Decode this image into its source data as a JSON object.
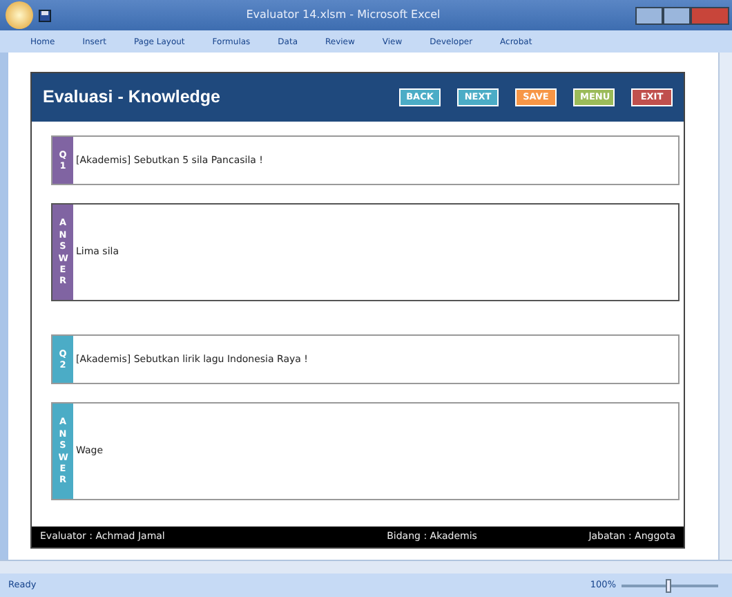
{
  "window": {
    "title": "Evaluator 14.xlsm - Microsoft Excel"
  },
  "ribbon_tabs": [
    "Home",
    "Insert",
    "Page Layout",
    "Formulas",
    "Data",
    "Review",
    "View",
    "Developer",
    "Acrobat"
  ],
  "form": {
    "title": "Evaluasi - Knowledge",
    "buttons": [
      {
        "label": "BACK",
        "color": "#4bacc6"
      },
      {
        "label": "NEXT",
        "color": "#4bacc6"
      },
      {
        "label": "SAVE",
        "color": "#f79646"
      },
      {
        "label": "MENU",
        "color": "#9bbb59"
      },
      {
        "label": "EXIT",
        "color": "#c0504d"
      }
    ],
    "questions": [
      {
        "number_label": "Q1",
        "color": "#8064a2",
        "question": "[Akademis] Sebutkan 5 sila Pancasila !",
        "answer_label": "ANSWER",
        "answer": "Lima sila",
        "selected": true
      },
      {
        "number_label": "Q2",
        "color": "#4bacc6",
        "question": "[Akademis] Sebutkan lirik lagu Indonesia Raya !",
        "answer_label": "ANSWER",
        "answer": "Wage",
        "selected": false
      }
    ],
    "footer": [
      "Evaluator : Achmad Jamal",
      "Bidang : Akademis",
      "Jabatan : Anggota"
    ]
  },
  "status_bar": {
    "text": "Ready",
    "zoom": "100%",
    "zoom_slider": {
      "level": 0.5
    }
  }
}
